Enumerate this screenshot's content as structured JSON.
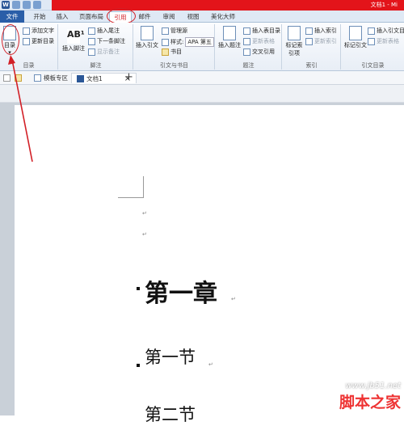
{
  "title_bar": {
    "window_title": "文档1 - Mi"
  },
  "tabs": [
    {
      "label": "文件"
    },
    {
      "label": "开始"
    },
    {
      "label": "插入"
    },
    {
      "label": "页面布局"
    },
    {
      "label": "引用"
    },
    {
      "label": "邮件"
    },
    {
      "label": "审阅"
    },
    {
      "label": "视图"
    },
    {
      "label": "美化大师"
    }
  ],
  "ribbon": {
    "toc": {
      "big_label": "目录",
      "add_text": "添加文字",
      "update": "更新目录",
      "group": "目录"
    },
    "footnote": {
      "big_label": "插入脚注",
      "insert_endnote": "插入尾注",
      "next_footnote": "下一条脚注",
      "show_notes": "显示备注",
      "group": "脚注"
    },
    "citation": {
      "big_label": "插入引文",
      "manage_sources": "管理源",
      "style_label": "样式:",
      "style_value": "APA 第五",
      "bibliography": "书目",
      "group": "引文与书目"
    },
    "caption": {
      "big_label": "插入题注",
      "insert_table_figures": "插入表目录",
      "update_table": "更新表格",
      "cross_ref": "交叉引用",
      "group": "题注"
    },
    "index": {
      "big_label": "标记索引项",
      "insert_index": "插入索引",
      "update_index": "更新索引",
      "group": "索引"
    },
    "toa": {
      "big_label": "标记引文",
      "insert_toa": "插入引文目",
      "update_toa": "更新表格",
      "group": "引文目录"
    }
  },
  "doc_tabs": {
    "template": "模板专区",
    "doc": "文档1",
    "new": "+",
    "close": "×"
  },
  "document": {
    "para_mark": "↵",
    "heading1": "第一章",
    "heading2a": "第一节",
    "heading2b": "第二节"
  },
  "watermark": {
    "site": "www.jb51.net",
    "brand": "脚本之家"
  },
  "colors": {
    "accent_red": "#e3141a",
    "file_tab": "#2a5ea8"
  }
}
